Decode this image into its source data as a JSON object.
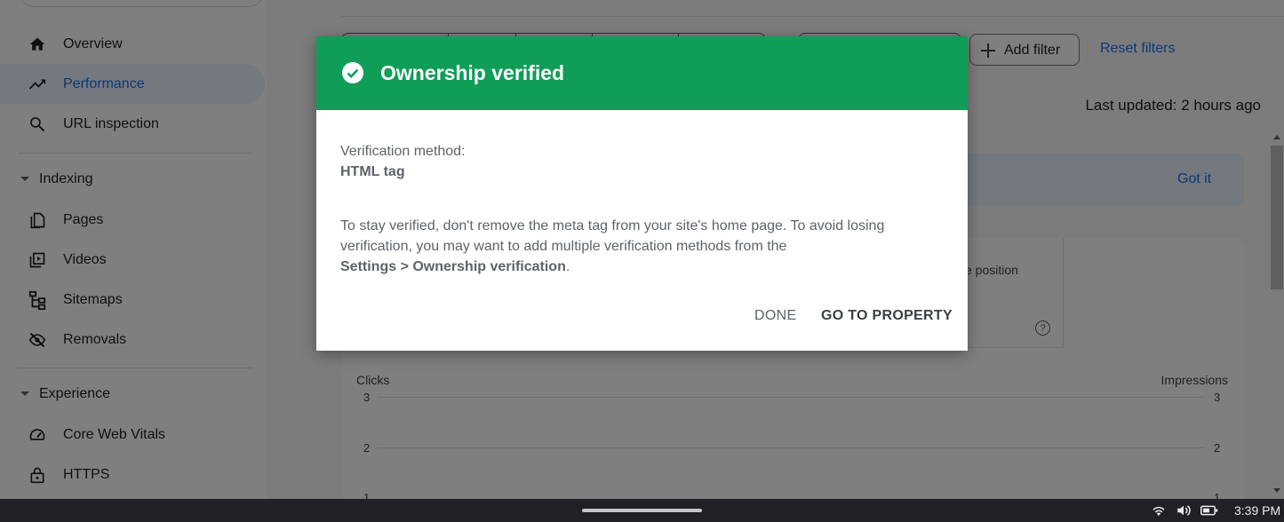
{
  "sidebar": {
    "items": [
      {
        "label": "Overview",
        "icon": "home-icon"
      },
      {
        "label": "Performance",
        "icon": "trending-up-icon",
        "active": true
      },
      {
        "label": "URL inspection",
        "icon": "search-icon"
      }
    ],
    "sections": [
      {
        "label": "Indexing",
        "items": [
          {
            "label": "Pages",
            "icon": "pages-icon"
          },
          {
            "label": "Videos",
            "icon": "video-icon"
          },
          {
            "label": "Sitemaps",
            "icon": "sitemap-icon"
          },
          {
            "label": "Removals",
            "icon": "visibility-off-icon"
          }
        ]
      },
      {
        "label": "Experience",
        "items": [
          {
            "label": "Core Web Vitals",
            "icon": "speed-icon"
          },
          {
            "label": "HTTPS",
            "icon": "lock-icon"
          }
        ]
      }
    ]
  },
  "toolbar": {
    "add_filter": "Add filter",
    "reset_filters": "Reset filters",
    "last_updated": "Last updated: 2 hours ago"
  },
  "banner": {
    "got_it": "Got it"
  },
  "metrics": {
    "partial_label": "e position"
  },
  "chart_data": {
    "type": "line",
    "left_axis_title": "Clicks",
    "right_axis_title": "Impressions",
    "left_ticks": [
      "3",
      "2",
      "1"
    ],
    "right_ticks": [
      "3",
      "2",
      "1"
    ],
    "ylim_left": [
      0,
      3
    ],
    "ylim_right": [
      0,
      3
    ],
    "grid": true
  },
  "dialog": {
    "title": "Ownership verified",
    "method_label": "Verification method:",
    "method_value": "HTML tag",
    "body_lead": "To stay verified, don't remove the meta tag from your site's home page. To avoid losing verification, you may want to add multiple verification methods from the",
    "body_path": "Settings > Ownership verification",
    "body_end": ".",
    "done": "DONE",
    "go_to_property": "GO TO PROPERTY",
    "header_color": "#0f9d58"
  },
  "taskbar": {
    "time": "3:39 PM"
  }
}
